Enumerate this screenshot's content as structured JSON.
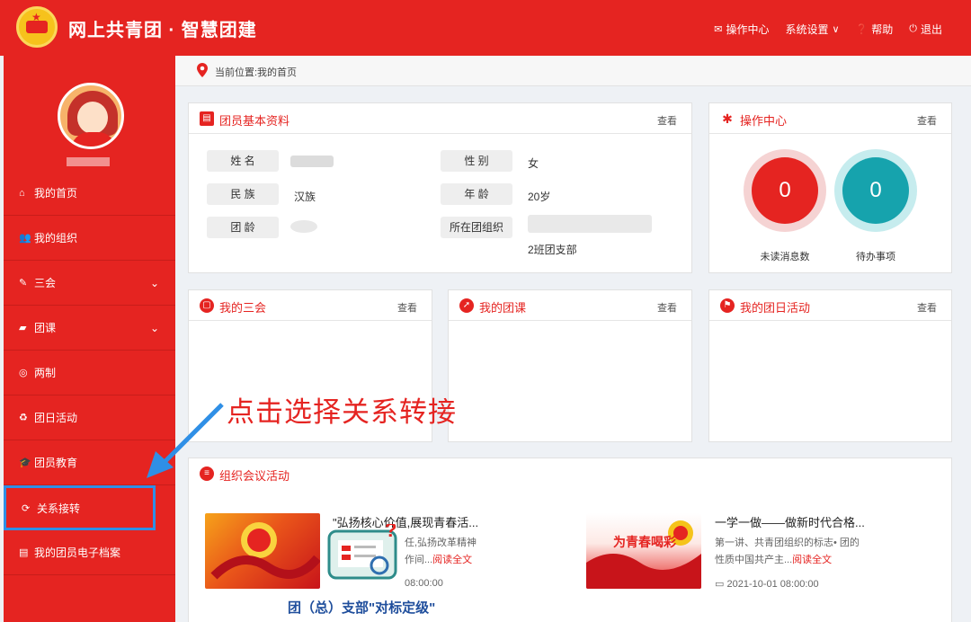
{
  "header": {
    "title": "网上共青团 · 智慧团建",
    "nav": [
      {
        "icon": "mail-icon",
        "label": "操作中心"
      },
      {
        "icon": "",
        "label": "系统设置"
      },
      {
        "icon": "help-icon",
        "label": "帮助"
      },
      {
        "icon": "power-icon",
        "label": "退出"
      }
    ]
  },
  "sidebar": {
    "items": [
      {
        "icon": "home-icon",
        "label": "我的首页"
      },
      {
        "icon": "group-icon",
        "label": "我的组织"
      },
      {
        "icon": "edit-icon",
        "label": "三会"
      },
      {
        "icon": "folder-icon",
        "label": "团课"
      },
      {
        "icon": "target-icon",
        "label": "两制"
      },
      {
        "icon": "recycle-icon",
        "label": "团日活动"
      },
      {
        "icon": "graduation-cap-icon",
        "label": "团员教育"
      },
      {
        "icon": "refresh-icon",
        "label": "关系接转"
      },
      {
        "icon": "document-icon",
        "label": "我的团员电子档案"
      }
    ]
  },
  "breadcrumb": {
    "text": "当前位置:我的首页"
  },
  "profile": {
    "title": "团员基本资料",
    "more": "查看",
    "labels": {
      "name": "姓 名",
      "gender": "性 别",
      "ethnicity": "民 族",
      "age": "年 龄",
      "league_age": "团 龄",
      "branch": "所在团组织"
    },
    "values": {
      "gender": "女",
      "ethnicity": "汉族",
      "age": "20岁",
      "branch": "2班团支部"
    }
  },
  "ops": {
    "title": "操作中心",
    "more": "查看",
    "unread_count": "0",
    "unread_label": "未读消息数",
    "todo_count": "0",
    "todo_label": "待办事项",
    "colors": {
      "unread": "#e52421",
      "todo": "#16a3ad"
    }
  },
  "cards": [
    {
      "title": "我的三会",
      "more": "查看"
    },
    {
      "title": "我的团课",
      "more": "查看"
    },
    {
      "title": "我的团日活动",
      "more": "查看"
    }
  ],
  "annotation": {
    "text": "点击选择关系转接"
  },
  "meetings": {
    "title": "组织会议活动",
    "items": [
      {
        "title": "\"弘扬核心价值,展现青春活...",
        "desc1": "任,弘扬改革精神",
        "desc2": "作间...",
        "read": "阅读全文",
        "date": "08:00:00"
      },
      {
        "title": "一学一做——做新时代合格...",
        "desc1": "第一讲、共青团组织的标志• 团的",
        "desc2": "性质中国共产主...",
        "read": "阅读全文",
        "date": "2021-10-01 08:00:00",
        "thumb_text": "为青春喝彩"
      }
    ],
    "overlay_caption": "团（总）支部\"对标定级\""
  }
}
